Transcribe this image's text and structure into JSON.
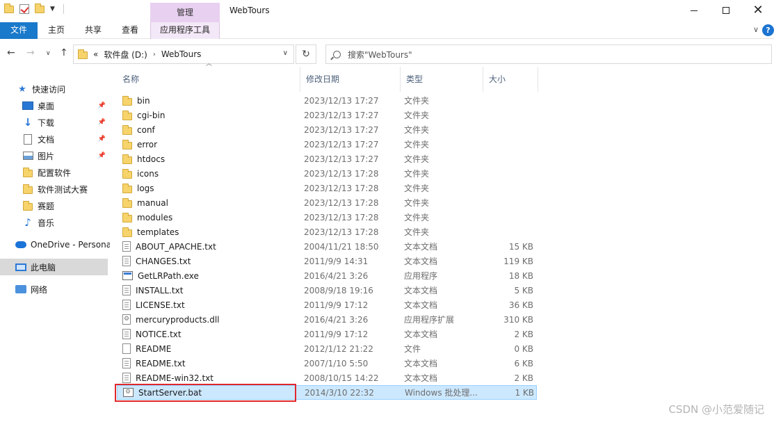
{
  "titlebar": {
    "manage_tab": "管理",
    "window_title": "WebTours"
  },
  "ribbon": {
    "tabs": [
      "文件",
      "主页",
      "共享",
      "查看",
      "应用程序工具"
    ]
  },
  "address": {
    "prefix": "«",
    "drive": "软件盘 (D:)",
    "folder": "WebTours",
    "search_placeholder": "搜索\"WebTours\""
  },
  "sidebar": {
    "items": [
      {
        "label": "快速访问",
        "icon": "star-icon"
      },
      {
        "label": "桌面",
        "icon": "desktop-icon",
        "pinned": true
      },
      {
        "label": "下载",
        "icon": "download-icon",
        "pinned": true
      },
      {
        "label": "文档",
        "icon": "document-icon",
        "pinned": true
      },
      {
        "label": "图片",
        "icon": "pictures-icon",
        "pinned": true
      },
      {
        "label": "配置软件",
        "icon": "folder-icon"
      },
      {
        "label": "软件测试大赛",
        "icon": "folder-icon"
      },
      {
        "label": "赛题",
        "icon": "folder-icon"
      },
      {
        "label": "音乐",
        "icon": "music-icon"
      },
      {
        "label": "OneDrive - Persona",
        "icon": "onedrive-icon"
      },
      {
        "label": "此电脑",
        "icon": "this-pc-icon"
      },
      {
        "label": "网络",
        "icon": "network-icon"
      }
    ]
  },
  "columns": {
    "name": "名称",
    "date": "修改日期",
    "type": "类型",
    "size": "大小"
  },
  "files": [
    {
      "name": "bin",
      "date": "2023/12/13 17:27",
      "type": "文件夹",
      "size": "",
      "icon": "folder"
    },
    {
      "name": "cgi-bin",
      "date": "2023/12/13 17:27",
      "type": "文件夹",
      "size": "",
      "icon": "folder"
    },
    {
      "name": "conf",
      "date": "2023/12/13 17:27",
      "type": "文件夹",
      "size": "",
      "icon": "folder"
    },
    {
      "name": "error",
      "date": "2023/12/13 17:27",
      "type": "文件夹",
      "size": "",
      "icon": "folder"
    },
    {
      "name": "htdocs",
      "date": "2023/12/13 17:27",
      "type": "文件夹",
      "size": "",
      "icon": "folder"
    },
    {
      "name": "icons",
      "date": "2023/12/13 17:28",
      "type": "文件夹",
      "size": "",
      "icon": "folder"
    },
    {
      "name": "logs",
      "date": "2023/12/13 17:28",
      "type": "文件夹",
      "size": "",
      "icon": "folder"
    },
    {
      "name": "manual",
      "date": "2023/12/13 17:28",
      "type": "文件夹",
      "size": "",
      "icon": "folder"
    },
    {
      "name": "modules",
      "date": "2023/12/13 17:28",
      "type": "文件夹",
      "size": "",
      "icon": "folder"
    },
    {
      "name": "templates",
      "date": "2023/12/13 17:28",
      "type": "文件夹",
      "size": "",
      "icon": "folder"
    },
    {
      "name": "ABOUT_APACHE.txt",
      "date": "2004/11/21 18:50",
      "type": "文本文档",
      "size": "15 KB",
      "icon": "doc"
    },
    {
      "name": "CHANGES.txt",
      "date": "2011/9/9 14:31",
      "type": "文本文档",
      "size": "119 KB",
      "icon": "doc"
    },
    {
      "name": "GetLRPath.exe",
      "date": "2016/4/21 3:26",
      "type": "应用程序",
      "size": "18 KB",
      "icon": "exe"
    },
    {
      "name": "INSTALL.txt",
      "date": "2008/9/18 19:16",
      "type": "文本文档",
      "size": "5 KB",
      "icon": "doc"
    },
    {
      "name": "LICENSE.txt",
      "date": "2011/9/9 17:12",
      "type": "文本文档",
      "size": "36 KB",
      "icon": "doc"
    },
    {
      "name": "mercuryproducts.dll",
      "date": "2016/4/21 3:26",
      "type": "应用程序扩展",
      "size": "310 KB",
      "icon": "dll"
    },
    {
      "name": "NOTICE.txt",
      "date": "2011/9/9 17:12",
      "type": "文本文档",
      "size": "2 KB",
      "icon": "doc"
    },
    {
      "name": "README",
      "date": "2012/1/12 21:22",
      "type": "文件",
      "size": "0 KB",
      "icon": "blank"
    },
    {
      "name": "README.txt",
      "date": "2007/1/10 5:50",
      "type": "文本文档",
      "size": "6 KB",
      "icon": "doc"
    },
    {
      "name": "README-win32.txt",
      "date": "2008/10/15 14:22",
      "type": "文本文档",
      "size": "2 KB",
      "icon": "doc"
    },
    {
      "name": "StartServer.bat",
      "date": "2014/3/10 22:32",
      "type": "Windows 批处理...",
      "size": "1 KB",
      "icon": "bat",
      "selected": true
    }
  ],
  "watermark": "CSDN @小范爱随记",
  "colors": {
    "file_tab": "#1979ca",
    "manage_tab": "#e8d0f0",
    "selection": "#cce8ff",
    "highlight_border": "#e0282c"
  }
}
